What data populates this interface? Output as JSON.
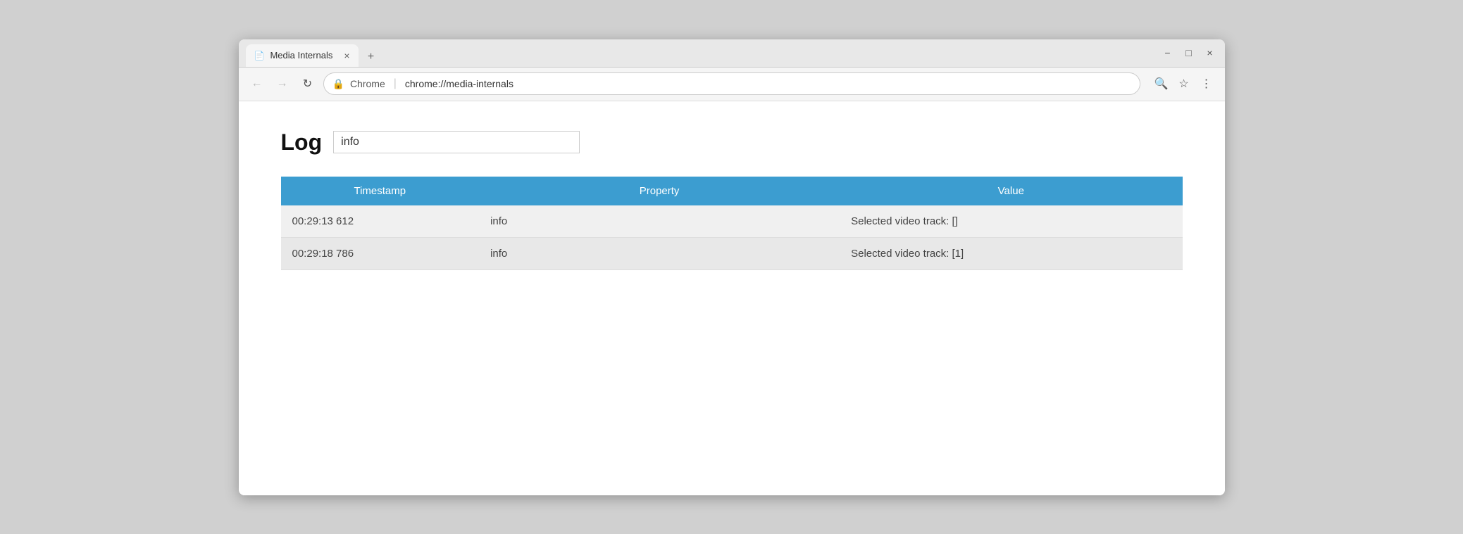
{
  "browser": {
    "tab_title": "Media Internals",
    "tab_close_icon": "×",
    "tab_new_icon": "+",
    "window_controls": {
      "minimize": "−",
      "maximize": "□",
      "close": "×"
    },
    "nav": {
      "back_label": "←",
      "forward_label": "→",
      "reload_label": "↻"
    },
    "address": {
      "secure_icon": "🔒",
      "origin": "Chrome",
      "separator": "|",
      "path": "chrome://media-internals"
    },
    "address_actions": {
      "search_icon": "🔍",
      "star_icon": "☆",
      "menu_icon": "⋮"
    }
  },
  "page": {
    "log_label": "Log",
    "filter_placeholder": "",
    "filter_value": "info",
    "table": {
      "headers": [
        "Timestamp",
        "Property",
        "Value"
      ],
      "rows": [
        {
          "timestamp": "00:29:13 612",
          "property": "info",
          "value": "Selected video track: []"
        },
        {
          "timestamp": "00:29:18 786",
          "property": "info",
          "value": "Selected video track: [1]"
        }
      ]
    }
  }
}
